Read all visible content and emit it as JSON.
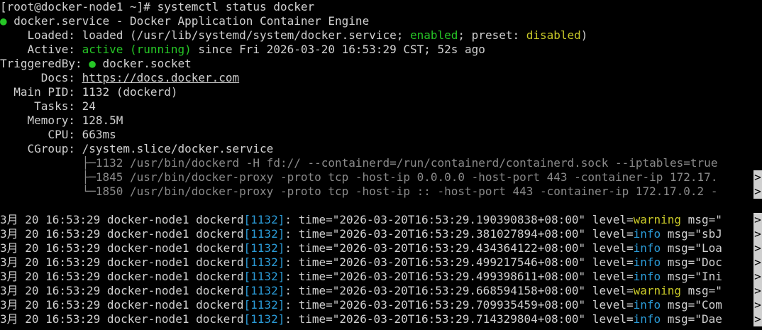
{
  "prompt": {
    "text": "[root@docker-node1 ~]# ",
    "command": "systemctl status docker"
  },
  "service": {
    "bullet": "●",
    "name": "docker.service",
    "separator": " - ",
    "description": "Docker Application Container Engine"
  },
  "loaded": {
    "label": "    Loaded: ",
    "prefix": "loaded (/usr/lib/systemd/system/docker.service; ",
    "state": "enabled",
    "mid": "; preset: ",
    "preset": "disabled",
    "suffix": ")"
  },
  "active": {
    "label": "    Active: ",
    "state": "active (running)",
    "since": " since Fri 2026-03-20 16:53:29 CST; 52s ago"
  },
  "triggered": {
    "label": "TriggeredBy: ",
    "bullet": "●",
    "value": " docker.socket"
  },
  "docs": {
    "label": "      Docs: ",
    "url": "https://docs.docker.com"
  },
  "main_pid": {
    "label": "  Main PID: ",
    "value": "1132 (dockerd)"
  },
  "tasks": {
    "label": "     Tasks: ",
    "value": "24"
  },
  "memory": {
    "label": "    Memory: ",
    "value": "128.5M"
  },
  "cpu": {
    "label": "       CPU: ",
    "value": "663ms"
  },
  "cgroup": {
    "label": "    CGroup: ",
    "value": "/system.slice/docker.service",
    "processes": [
      {
        "tree": "            ├─",
        "pid": "1132",
        "cmd": " /usr/bin/dockerd -H fd:// --containerd=/run/containerd/containerd.sock --iptables=true",
        "truncated": false
      },
      {
        "tree": "            ├─",
        "pid": "1845",
        "cmd": " /usr/bin/docker-proxy -proto tcp -host-ip 0.0.0.0 -host-port 443 -container-ip 172.17.",
        "truncated": true
      },
      {
        "tree": "            └─",
        "pid": "1850",
        "cmd": " /usr/bin/docker-proxy -proto tcp -host-ip :: -host-port 443 -container-ip 172.17.0.2 -",
        "truncated": true
      }
    ]
  },
  "overflow_glyph": ">",
  "logs": [
    {
      "date": "3月 20 16:53:29 docker-node1 dockerd",
      "pid": "[1132]",
      "time": ": time=\"2026-03-20T16:53:29.190390838+08:00\" level=",
      "level": "warning",
      "level_color": "yellow",
      "msg": " msg=\""
    },
    {
      "date": "3月 20 16:53:29 docker-node1 dockerd",
      "pid": "[1132]",
      "time": ": time=\"2026-03-20T16:53:29.381027894+08:00\" level=",
      "level": "info",
      "level_color": "cyan",
      "msg": " msg=\"sbJ"
    },
    {
      "date": "3月 20 16:53:29 docker-node1 dockerd",
      "pid": "[1132]",
      "time": ": time=\"2026-03-20T16:53:29.434364122+08:00\" level=",
      "level": "info",
      "level_color": "cyan",
      "msg": " msg=\"Loa"
    },
    {
      "date": "3月 20 16:53:29 docker-node1 dockerd",
      "pid": "[1132]",
      "time": ": time=\"2026-03-20T16:53:29.499217546+08:00\" level=",
      "level": "info",
      "level_color": "cyan",
      "msg": " msg=\"Doc"
    },
    {
      "date": "3月 20 16:53:29 docker-node1 dockerd",
      "pid": "[1132]",
      "time": ": time=\"2026-03-20T16:53:29.499398611+08:00\" level=",
      "level": "info",
      "level_color": "cyan",
      "msg": " msg=\"Ini"
    },
    {
      "date": "3月 20 16:53:29 docker-node1 dockerd",
      "pid": "[1132]",
      "time": ": time=\"2026-03-20T16:53:29.668594158+08:00\" level=",
      "level": "warning",
      "level_color": "yellow",
      "msg": " msg=\""
    },
    {
      "date": "3月 20 16:53:29 docker-node1 dockerd",
      "pid": "[1132]",
      "time": ": time=\"2026-03-20T16:53:29.709935459+08:00\" level=",
      "level": "info",
      "level_color": "cyan",
      "msg": " msg=\"Com"
    },
    {
      "date": "3月 20 16:53:29 docker-node1 dockerd",
      "pid": "[1132]",
      "time": ": time=\"2026-03-20T16:53:29.714329804+08:00\" level=",
      "level": "info",
      "level_color": "cyan",
      "msg": " msg=\"Dae"
    }
  ],
  "colors": {
    "background": "#000000",
    "foreground": "#d0d0d0",
    "green": "#26c626",
    "yellow": "#c9c928",
    "cyan": "#2a9ad6",
    "gray": "#8a8a8a"
  }
}
